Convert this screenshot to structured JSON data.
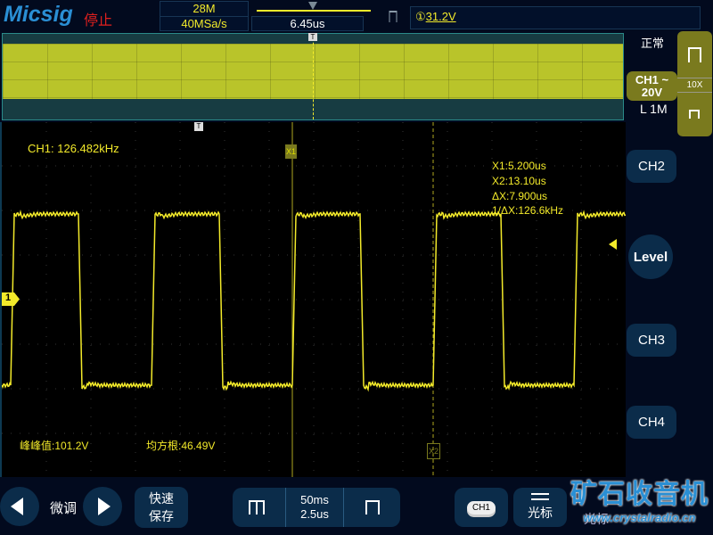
{
  "header": {
    "brand": "Micsig",
    "run_state": "停止",
    "memory_depth": "28M",
    "sample_rate": "40MSa/s",
    "trigger_position": "6.45us",
    "trigger_level": "31.2V",
    "trigger_channel_marker": "①"
  },
  "right_panel": {
    "trigger_mode": "正常",
    "ch1": {
      "label": "CH1",
      "coupling_symbol": "~",
      "scale": "20V",
      "impedance": "L 1M"
    },
    "probe": "10X",
    "ch2": "CH2",
    "level": "Level",
    "ch3": "CH3",
    "ch4": "CH4"
  },
  "plot": {
    "freq_readout": "CH1: 126.482kHz",
    "cursors": {
      "x1_marker": "X1",
      "x2_marker": "X2",
      "x1": "X1:5.200us",
      "x2": "X2:13.10us",
      "dx": "ΔX:7.900us",
      "inv_dx": "1/ΔX:126.6kHz"
    },
    "measurements": [
      {
        "label": "峰峰值:101.2V"
      },
      {
        "label": "均方根:46.49V"
      }
    ],
    "ch1_marker": "1"
  },
  "bottom": {
    "fine_adjust": "微调",
    "quick_save_1": "快速",
    "quick_save_2": "保存",
    "timebase_1": "50ms",
    "timebase_2": "2.5us",
    "ch1_button": "CH1",
    "cursor_label": "光标",
    "cursor_label2": "光标"
  },
  "watermark": {
    "title": "矿石收音机",
    "url": "www.crystalradio.cn"
  },
  "colors": {
    "trace": "#f3ea2a",
    "panel": "#0b2c4a",
    "ch1": "#7a7a1e"
  }
}
